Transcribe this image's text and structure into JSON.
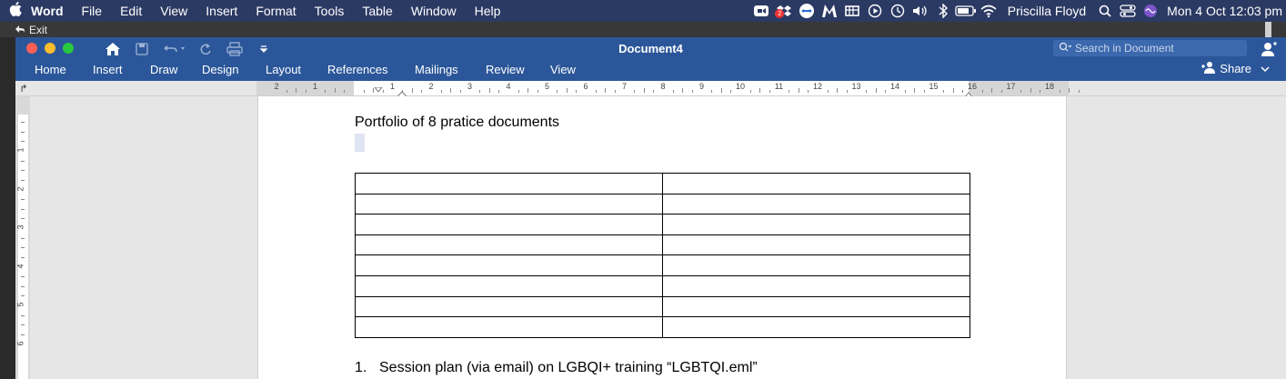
{
  "menubar": {
    "app_name": "Word",
    "menus": [
      "File",
      "Edit",
      "View",
      "Insert",
      "Format",
      "Tools",
      "Table",
      "Window",
      "Help"
    ],
    "status_icons": [
      "zoom-icon",
      "dropbox-icon",
      "teamviewer-icon",
      "malwarebytes-icon",
      "rollout-icon",
      "play-icon",
      "time-machine-icon",
      "volume-icon",
      "bluetooth-icon",
      "battery-icon",
      "wifi-icon"
    ],
    "dropbox_badge": "2",
    "user_name": "Priscilla Floyd",
    "datetime": "Mon 4 Oct  12:03 pm"
  },
  "exitbar": {
    "exit_label": "Exit"
  },
  "window": {
    "title": "Document4",
    "search_placeholder": "Search in Document",
    "tabs": [
      "Home",
      "Insert",
      "Draw",
      "Design",
      "Layout",
      "References",
      "Mailings",
      "Review",
      "View"
    ],
    "share_label": "Share"
  },
  "ruler": {
    "numbers": [
      "2",
      "1",
      "",
      "1",
      "2",
      "3",
      "4",
      "5",
      "6",
      "7",
      "8",
      "9",
      "10",
      "11",
      "12",
      "13",
      "14",
      "15",
      "16",
      "17",
      "18"
    ]
  },
  "vruler": {
    "numbers": [
      "1",
      "2",
      "3",
      "4",
      "5",
      "6"
    ]
  },
  "document": {
    "title": "Portfolio of 8 pratice documents",
    "table": {
      "rows": 8,
      "cols": 2
    },
    "list_number": "1.",
    "list_text": "Session plan (via email) on LGBQI+ training “LGBTQI.eml”"
  },
  "colors": {
    "word_blue": "#2b579a",
    "menubar_bg": "#2b3a63",
    "close": "#ff5f57",
    "minimize": "#febc2e",
    "zoom": "#28c840"
  }
}
